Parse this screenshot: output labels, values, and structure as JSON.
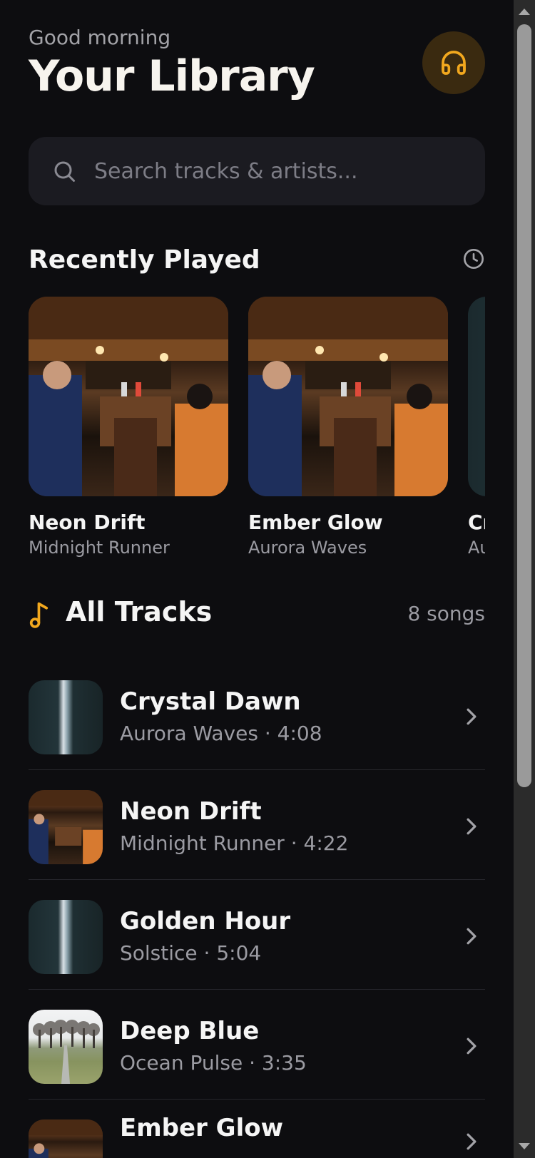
{
  "header": {
    "greeting": "Good morning",
    "title": "Your Library",
    "avatar_icon": "headphones-icon",
    "accent": "#f2a81e"
  },
  "search": {
    "placeholder": "Search tracks & artists..."
  },
  "recent": {
    "title": "Recently Played",
    "items": [
      {
        "title": "Neon Drift",
        "artist": "Midnight Runner",
        "art": "bar-scene"
      },
      {
        "title": "Ember Glow",
        "artist": "Aurora Waves",
        "art": "bar-scene"
      },
      {
        "title": "Cr",
        "artist": "Au",
        "art": "tower-scene"
      }
    ]
  },
  "tracks": {
    "title": "All Tracks",
    "count": "8 songs",
    "items": [
      {
        "title": "Crystal Dawn",
        "meta": "Aurora Waves · 4:08",
        "art": "tower-scene"
      },
      {
        "title": "Neon Drift",
        "meta": "Midnight Runner · 4:22",
        "art": "bar-scene"
      },
      {
        "title": "Golden Hour",
        "meta": "Solstice · 5:04",
        "art": "tower-scene"
      },
      {
        "title": "Deep Blue",
        "meta": "Ocean Pulse · 3:35",
        "art": "trees-scene"
      },
      {
        "title": "Ember Glow",
        "meta": "",
        "art": "bar-scene"
      }
    ]
  }
}
